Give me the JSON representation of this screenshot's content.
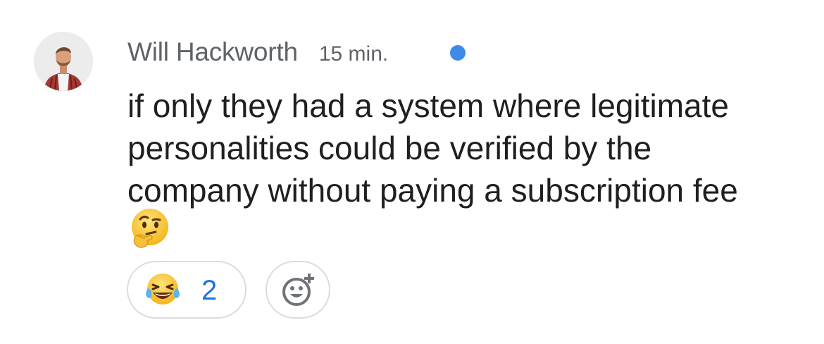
{
  "comment": {
    "author": "Will Hackworth",
    "time": "15 min.",
    "unread_dot_color": "#3d8be8",
    "text_lines": [
      "if only they had a system where legitimate",
      "personalities could be verified by the",
      "company without paying a subscription fee"
    ],
    "inline_emoji": "thinking-face",
    "reactions": [
      {
        "emoji": "face-with-tears-of-joy",
        "count": "2",
        "count_color": "#1a73e8"
      }
    ],
    "add_reaction_icon": "add-reaction-icon"
  }
}
